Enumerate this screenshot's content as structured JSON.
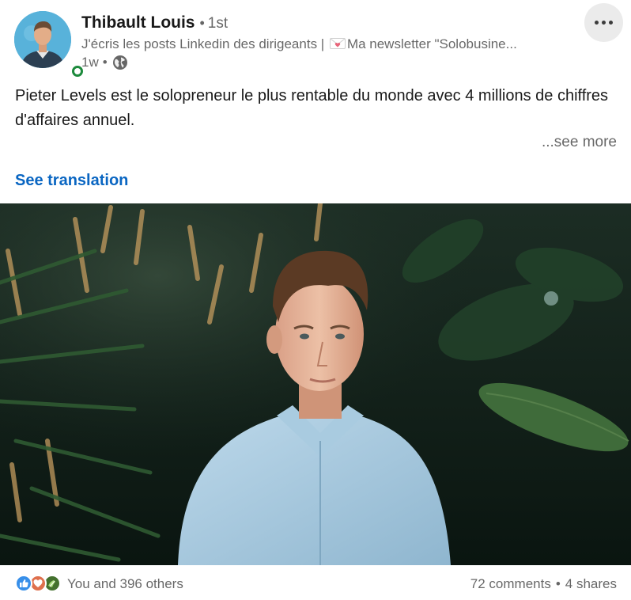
{
  "post": {
    "author": {
      "name": "Thibault Louis",
      "degree_separator": "•",
      "degree": "1st",
      "headline_text": "J'écris les posts Linkedin des dirigeants | ",
      "headline_emoji": "love-letter-icon",
      "headline_tail": "Ma newsletter \"Solobusine...",
      "time": "1w",
      "time_separator": "•",
      "visibility_icon": "globe-icon",
      "online_status_color": "#1c8a3c"
    },
    "more_menu_icon": "ellipsis-icon",
    "body": {
      "text": "Pieter Levels est le solopreneur le plus rentable du monde avec 4 millions de chiffres d'affaires annuel.",
      "see_more": "...see more",
      "see_translation": "See translation"
    },
    "image": {
      "subject": "photo-portrait"
    },
    "social": {
      "reaction_icons": [
        "like-icon",
        "love-icon",
        "support-icon"
      ],
      "reactions_text": "You and 396 others",
      "comments": "72 comments",
      "separator": "•",
      "shares": "4 shares"
    }
  },
  "colors": {
    "link_blue": "#0a66c2",
    "secondary_text": "#666666",
    "more_button_bg": "#ebebeb"
  }
}
